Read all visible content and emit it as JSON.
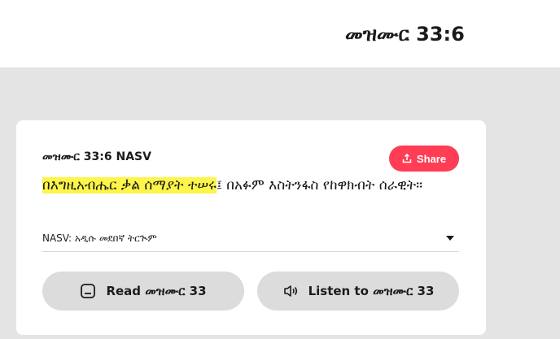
{
  "header": {
    "title": "መዝሙር 33:6"
  },
  "card": {
    "reference": "መዝሙር 33:6 NASV",
    "share_label": "Share",
    "verse_highlighted": "በእግዚአብሔር ቃል ሰማያት ተሠሩ",
    "verse_rest": "፤ በአፉም እስትንፋስ የከዋክብት ሰራዊት።",
    "highlight_color": "#fdf54a",
    "version_selector": "NASV: አዲሱ መደበኛ ትርጒም",
    "read_label": "Read መዝሙር 33",
    "listen_label": "Listen to መዝሙር 33",
    "accent_color": "#ff3d54"
  }
}
